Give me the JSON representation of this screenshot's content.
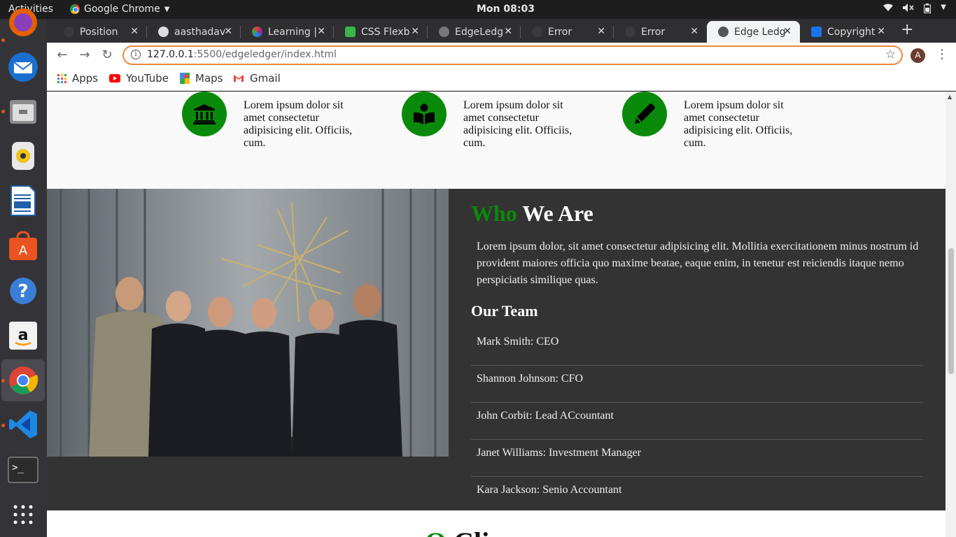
{
  "topbar": {
    "activities": "Activities",
    "app_name": "Google Chrome",
    "clock": "Mon 08:03"
  },
  "tabs": [
    {
      "label": "Position",
      "icon": "github-icon"
    },
    {
      "label": "aasthadav",
      "icon": "github-icon"
    },
    {
      "label": "Learning |",
      "icon": "learning-icon"
    },
    {
      "label": "CSS Flexb",
      "icon": "flexbox-icon"
    },
    {
      "label": "EdgeLedg",
      "icon": "edge-icon"
    },
    {
      "label": "Error",
      "icon": "error-icon"
    },
    {
      "label": "Error",
      "icon": "error-icon"
    },
    {
      "label": "Edge Ledg",
      "icon": "globe-icon",
      "active": true
    },
    {
      "label": "Copyright",
      "icon": "flag-icon"
    }
  ],
  "address_bar": {
    "host": "127.0.0.1",
    "path": ":5500/edgeledger/index.html"
  },
  "profile_initial": "A",
  "bookmarks": [
    {
      "label": "Apps",
      "icon": "apps-grid-icon"
    },
    {
      "label": "YouTube",
      "icon": "youtube-icon"
    },
    {
      "label": "Maps",
      "icon": "maps-icon"
    },
    {
      "label": "Gmail",
      "icon": "gmail-icon"
    }
  ],
  "features": [
    {
      "icon": "bank-icon",
      "text": "Lorem ipsum dolor sit amet consectetur adipisicing elit. Officiis, cum."
    },
    {
      "icon": "book-reader-icon",
      "text": "Lorem ipsum dolor sit amet consectetur adipisicing elit. Officiis, cum."
    },
    {
      "icon": "pencil-icon",
      "text": "Lorem ipsum dolor sit amet consectetur adipisicing elit. Officiis, cum."
    }
  ],
  "who_we_are": {
    "title_accent": "Who",
    "title_rest": " We Are",
    "text": "Lorem ipsum dolor, sit amet consectetur adipisicing elit. Mollitia exercitationem minus nostrum id provident maiores officia quo maxime beatae, eaque enim, in tenetur est reiciendis itaque nemo perspiciatis similique quas.",
    "team_title": "Our Team",
    "team": [
      "Mark Smith: CEO",
      "Shannon Johnson: CFO",
      "John Corbit: Lead ACcountant",
      "Janet Williams: Investment Manager",
      "Kara Jackson: Senio Accountant"
    ]
  },
  "clients": {
    "title_accent": "O",
    "title_rest": "Cli"
  },
  "colors": {
    "accent_green": "#0a8a0a",
    "dark_section": "#333333",
    "omnibox_focus": "#e8873b"
  }
}
